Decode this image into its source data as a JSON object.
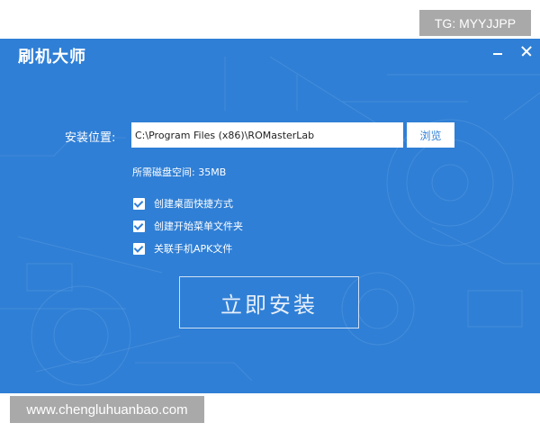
{
  "watermarks": {
    "top_right": "TG: MYYJJPP",
    "bottom_left": "www.chengluhuanbao.com"
  },
  "window": {
    "title": "刷机大师",
    "controls": {
      "minimize_icon": "minimize-icon",
      "close_icon": "close-icon"
    }
  },
  "install": {
    "location_label": "安装位置:",
    "path_value": "C:\\Program Files (x86)\\ROMasterLab",
    "browse_label": "浏览",
    "disk_space": "所需磁盘空间: 35MB",
    "options": [
      {
        "label": "创建桌面快捷方式",
        "checked": true
      },
      {
        "label": "创建开始菜单文件夹",
        "checked": true
      },
      {
        "label": "关联手机APK文件",
        "checked": true
      }
    ],
    "install_button": "立即安装"
  },
  "colors": {
    "window_bg": "#2f7fd6",
    "watermark_bg": "#a9a9a9"
  }
}
